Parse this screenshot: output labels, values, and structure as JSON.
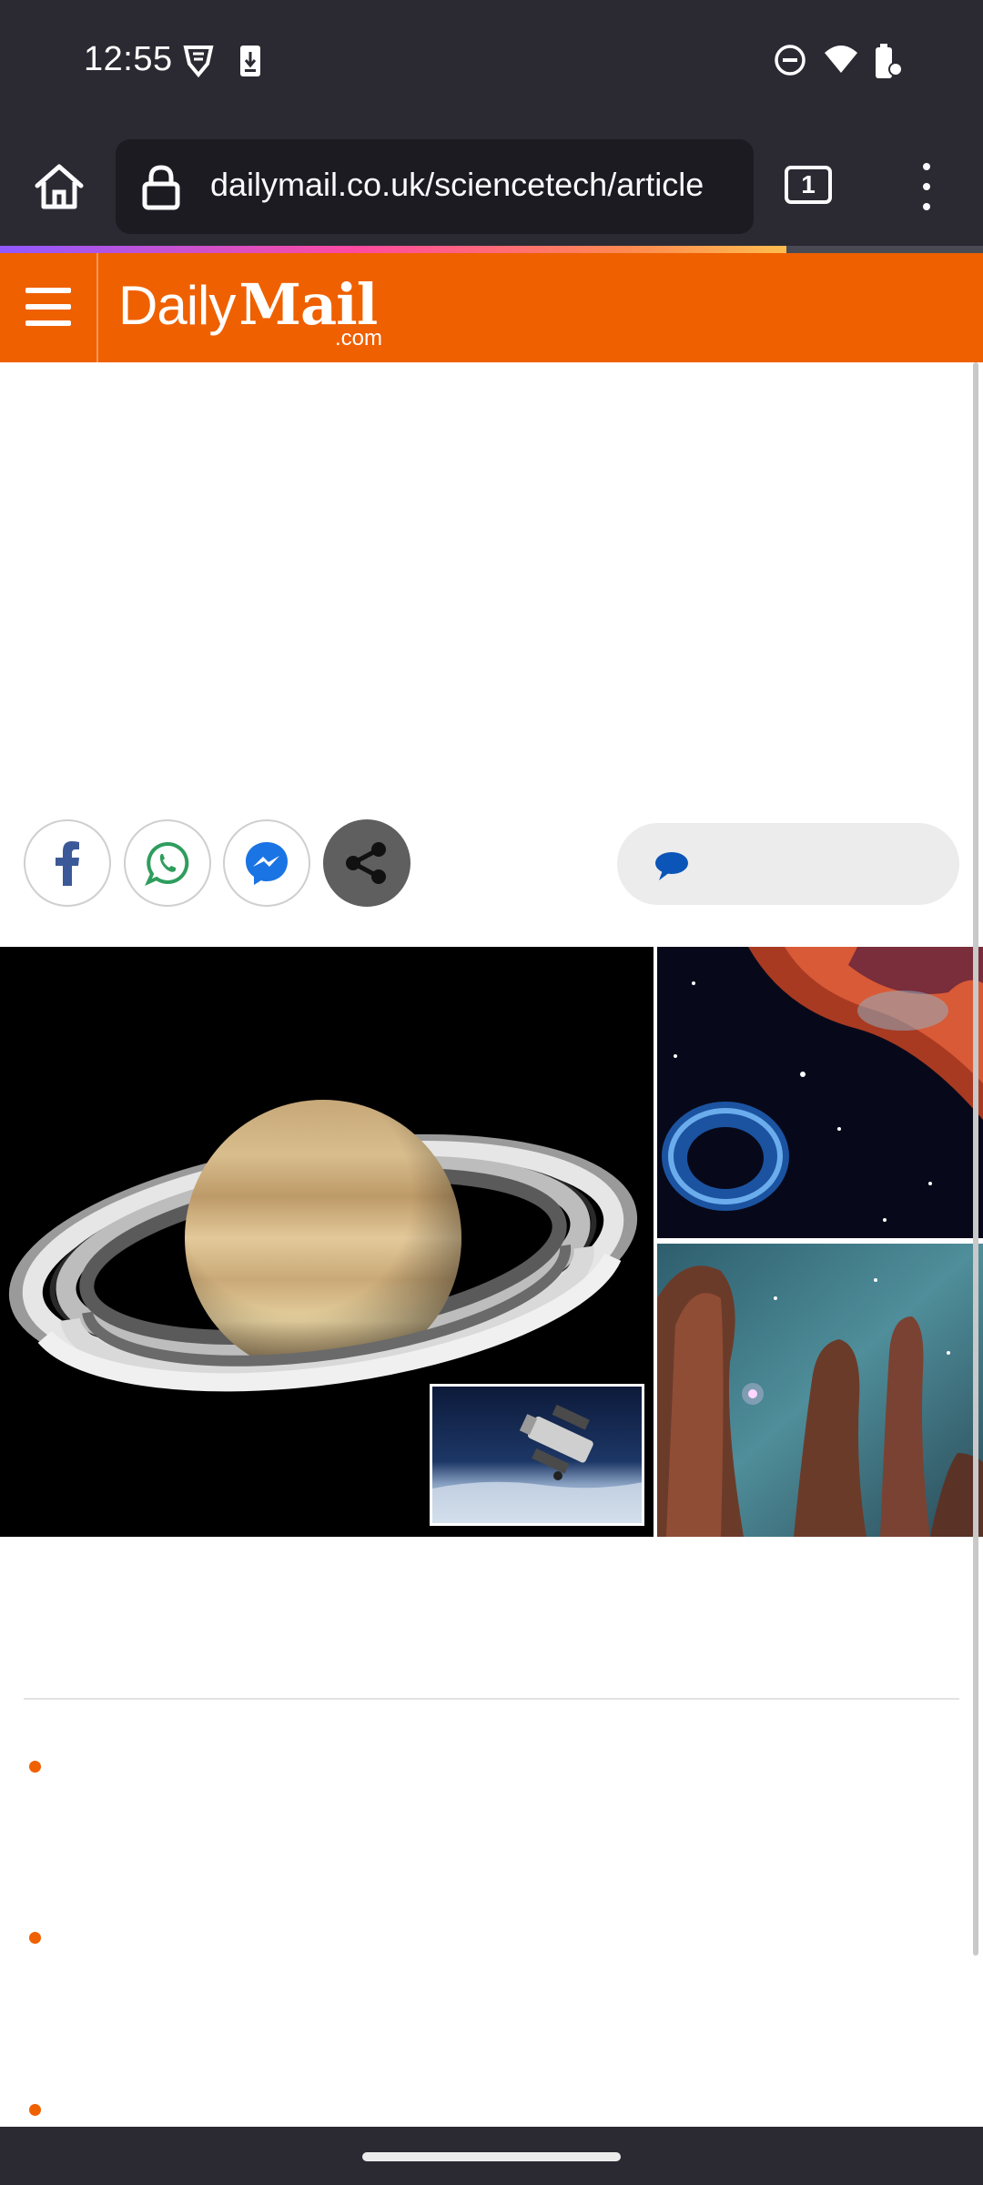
{
  "status_bar": {
    "time": "12:55",
    "left_icons": [
      "vpn-shield-icon",
      "download-icon"
    ],
    "right_icons": [
      "do-not-disturb-icon",
      "wifi-icon",
      "battery-icon"
    ]
  },
  "browser": {
    "url": "dailymail.co.uk/sciencetech/article",
    "tab_count": "1",
    "icons": [
      "home-icon",
      "lock-icon",
      "tabs-icon",
      "menu-icon"
    ],
    "page_load_progress": 0.8
  },
  "site_header": {
    "logo_daily": "Daily",
    "logo_mail": "Mail",
    "logo_dotcom": ".com",
    "accent_color": "#ef6000"
  },
  "share": {
    "buttons": [
      "facebook-icon",
      "whatsapp-icon",
      "messenger-icon",
      "share-icon"
    ],
    "comments_icon": "comment-bubble-icon"
  },
  "collage": {
    "images": [
      "saturn-image",
      "hubble-telescope-inset-image",
      "nebula-image",
      "pillars-of-creation-image"
    ]
  }
}
